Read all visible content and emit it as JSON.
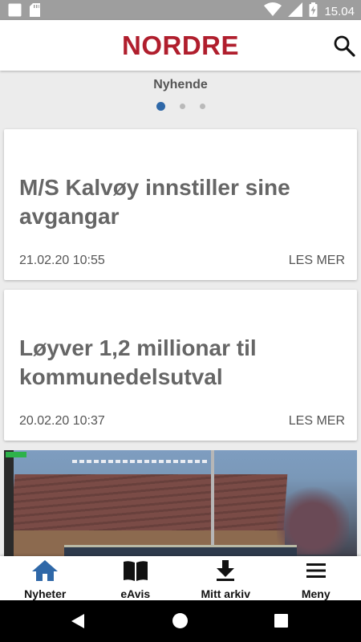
{
  "status_bar": {
    "time": "15.04",
    "icons": [
      "notification-square-icon",
      "sd-card-icon",
      "wifi-icon",
      "signal-icon",
      "battery-charging-icon"
    ]
  },
  "header": {
    "brand": "NORDRE",
    "brand_color": "#b01e2d",
    "search_icon": "search-icon"
  },
  "section": {
    "title": "Nyhende",
    "carousel_pages": 3,
    "carousel_active_index": 0,
    "accent": "#2f68a8"
  },
  "articles": [
    {
      "title": "M/S Kalvøy innstiller sine avgangar",
      "date": "21.02.20 10:55",
      "more": "LES MER"
    },
    {
      "title": "Løyver 1,2 millionar til kommunedelsutval",
      "date": "20.02.20 10:37",
      "more": "LES MER"
    }
  ],
  "bottom_nav": {
    "items": [
      {
        "label": "Nyheter",
        "icon": "home-icon",
        "active": true
      },
      {
        "label": "eAvis",
        "icon": "open-book-icon",
        "active": false
      },
      {
        "label": "Mitt arkiv",
        "icon": "download-icon",
        "active": false
      },
      {
        "label": "Meny",
        "icon": "menu-icon",
        "active": false
      }
    ]
  },
  "system_nav": {
    "icons": [
      "back-icon",
      "home-circle-icon",
      "recents-icon"
    ]
  }
}
